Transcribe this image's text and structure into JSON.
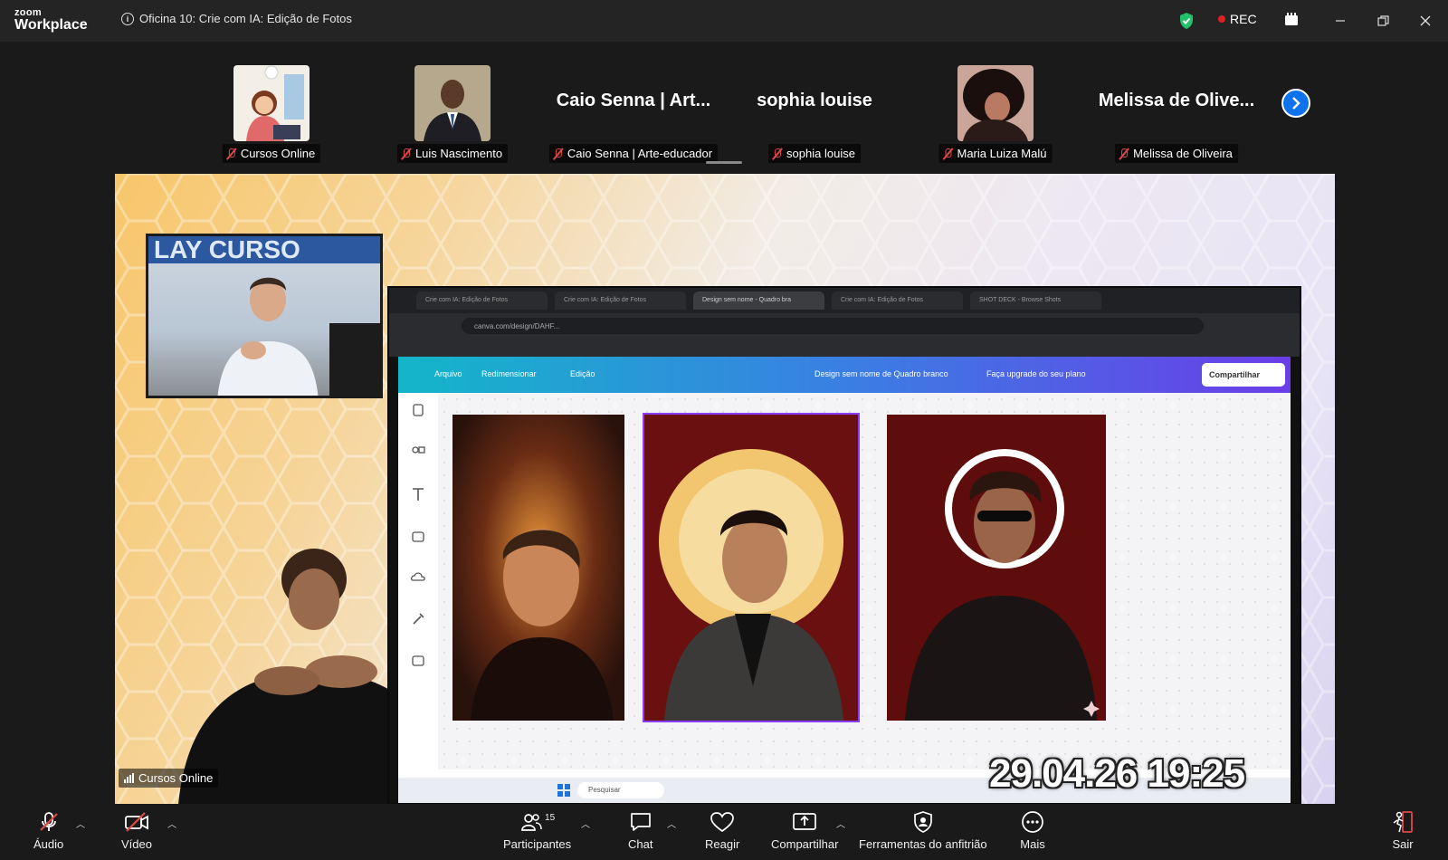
{
  "app": {
    "logo_line1": "zoom",
    "logo_line2": "Workplace",
    "meeting_title": "Oficina 10: Crie com IA: Edição de Fotos",
    "rec_label": "REC",
    "accent": "#0e72ed"
  },
  "participants": [
    {
      "name": "Cursos Online",
      "display": "avatar"
    },
    {
      "name": "Luis Nascimento",
      "display": "avatar"
    },
    {
      "name": "Caio Senna | Arte-educador",
      "display": "name",
      "big_label": "Caio Senna | Art..."
    },
    {
      "name": "sophia louise",
      "display": "name",
      "big_label": "sophia louise"
    },
    {
      "name": "Maria Luiza Malú",
      "display": "avatar"
    },
    {
      "name": "Melissa de Oliveira",
      "display": "name",
      "big_label": "Melissa  de  Olive..."
    }
  ],
  "share": {
    "sharer_label": "Cursos Online",
    "inset_banner": "LAY CURSO",
    "timestamp": "29.04.26 19:25",
    "browser_tabs": [
      "Crie com IA: Edição de Fotos",
      "Crie com IA: Edição de Fotos",
      "Design sem nome - Quadro bra",
      "Crie com IA: Edição de Fotos",
      "SHOT DECK - Browse Shots"
    ],
    "url": "canva.com/design/DAHF...",
    "canva_menu": [
      "Arquivo",
      "Redimensionar",
      "Edição"
    ],
    "canva_doc_title": "Design sem nome de Quadro branco",
    "canva_upgrade": "Faça upgrade do seu plano",
    "canva_share": "Compartilhar",
    "canva_side": [
      "Modelos",
      "Elementos",
      "Texto",
      "Marca",
      "Uploads",
      "Ferramentas",
      "Projetos"
    ],
    "taskbar_search": "Pesquisar"
  },
  "toolbar": {
    "audio": "Áudio",
    "video": "Vídeo",
    "participants": "Participantes",
    "participants_count": "15",
    "chat": "Chat",
    "react": "Reagir",
    "share": "Compartilhar",
    "host_tools": "Ferramentas do anfitrião",
    "more": "Mais",
    "leave": "Sair"
  }
}
